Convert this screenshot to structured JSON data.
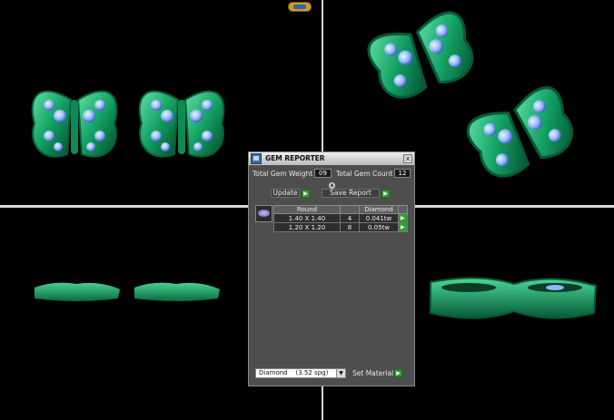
{
  "viewports": [
    {
      "name": "top-left"
    },
    {
      "name": "top-right"
    },
    {
      "name": "bottom-left"
    },
    {
      "name": "bottom-right"
    }
  ],
  "colors": {
    "background": "#000000",
    "gem_green": "#1aa56a",
    "stone_blue": "#9ec4ff",
    "button_green": "#2fa02f",
    "panel_gray": "#4e4e4e"
  },
  "gem_reporter": {
    "title": "GEM REPORTER",
    "close_label": "x",
    "total_weight_label": "Total Gem Weight",
    "total_weight_value": "09",
    "total_count_label": "Total Gem Count",
    "total_count_value": "12",
    "update_label": "Update",
    "save_report_label": "Save Report",
    "table": {
      "headers": [
        "Round",
        "",
        "Diamond",
        ""
      ],
      "rows": [
        {
          "size": "1.40 X 1.40",
          "count": "4",
          "weight": "0.041tw"
        },
        {
          "size": "1.20 X 1.20",
          "count": "8",
          "weight": "0.05tw"
        }
      ]
    },
    "material": {
      "selected": "Diamond    (3.52 spg)",
      "set_label": "Set Material"
    }
  }
}
